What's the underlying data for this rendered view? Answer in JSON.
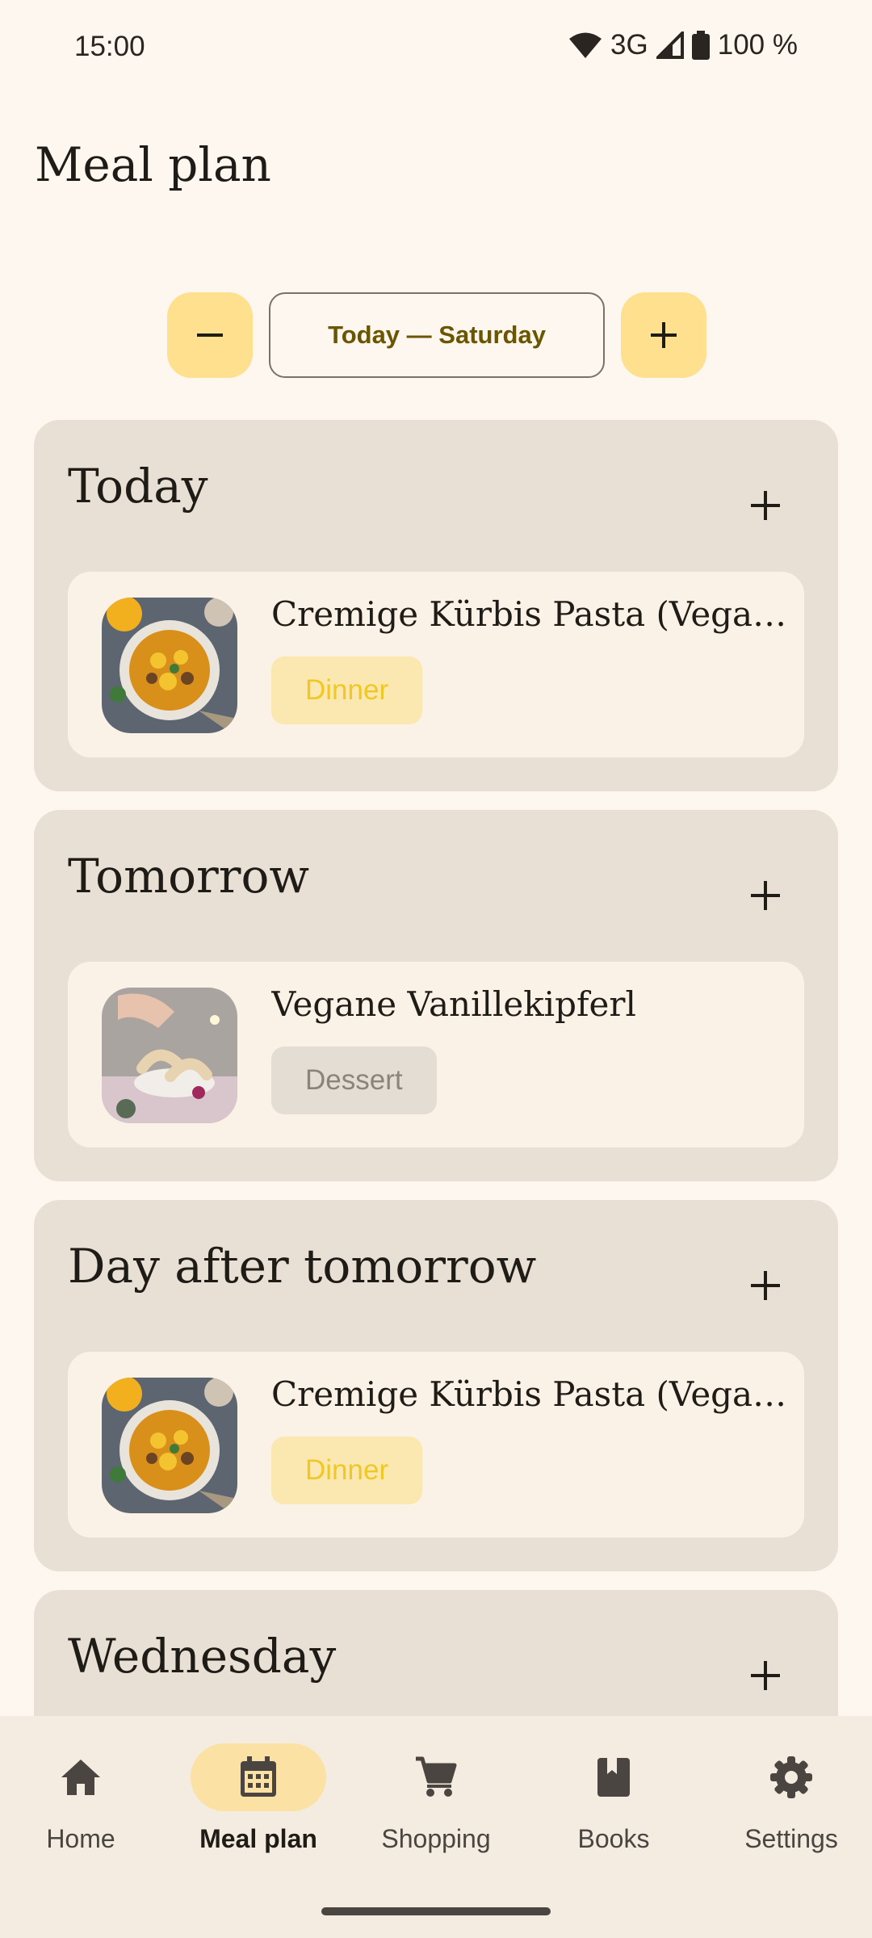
{
  "status": {
    "time": "15:00",
    "network": "3G",
    "battery": "100 %"
  },
  "header": {
    "title": "Meal plan"
  },
  "date_nav": {
    "label": "Today — Saturday"
  },
  "days": [
    {
      "title": "Today",
      "meal": {
        "name": "Cremige Kürbis Pasta (Vegan...",
        "tag": "Dinner"
      }
    },
    {
      "title": "Tomorrow",
      "meal": {
        "name": "Vegane Vanillekipferl",
        "tag": "Dessert"
      }
    },
    {
      "title": "Day after tomorrow",
      "meal": {
        "name": "Cremige Kürbis Pasta (Vegan...",
        "tag": "Dinner"
      }
    },
    {
      "title": "Wednesday"
    }
  ],
  "bottom_nav": {
    "items": [
      {
        "label": "Home",
        "icon": "home-icon"
      },
      {
        "label": "Meal plan",
        "icon": "calendar-icon",
        "active": true
      },
      {
        "label": "Shopping",
        "icon": "cart-icon"
      },
      {
        "label": "Books",
        "icon": "book-icon"
      },
      {
        "label": "Settings",
        "icon": "gear-icon"
      }
    ]
  },
  "colors": {
    "accent": "#ffe08f",
    "card": "#e9e0d5",
    "background": "#fdf7f0"
  }
}
